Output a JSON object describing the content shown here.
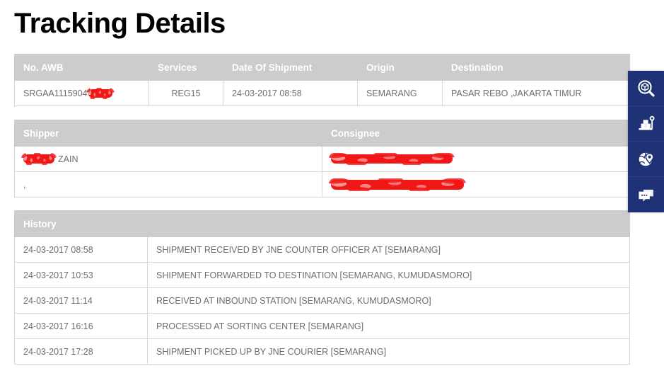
{
  "page": {
    "title": "Tracking Details"
  },
  "shipment_table": {
    "headers": [
      "No. AWB",
      "Services",
      "Date Of Shipment",
      "Origin",
      "Destination"
    ],
    "row": {
      "awb": "SRGAA1115904",
      "awb_redacted": true,
      "services": "REG15",
      "date_of_shipment": "24-03-2017 08:58",
      "origin": "SEMARANG",
      "destination": "PASAR REBO ,JAKARTA TIMUR"
    }
  },
  "parties_table": {
    "headers": [
      "Shipper",
      "Consignee"
    ],
    "rows": [
      {
        "shipper": "ZAIN",
        "shipper_redacted": true,
        "consignee": "",
        "consignee_redacted": true
      },
      {
        "shipper": ",",
        "shipper_redacted": false,
        "consignee": "",
        "consignee_redacted": true
      }
    ]
  },
  "history_table": {
    "header": "History",
    "rows": [
      {
        "time": "24-03-2017 08:58",
        "status": "SHIPMENT RECEIVED BY JNE COUNTER OFFICER AT [SEMARANG]"
      },
      {
        "time": "24-03-2017 10:53",
        "status": "SHIPMENT FORWARDED TO DESTINATION [SEMARANG, KUMUDASMORO]"
      },
      {
        "time": "24-03-2017 11:14",
        "status": "RECEIVED AT INBOUND STATION [SEMARANG, KUMUDASMORO]"
      },
      {
        "time": "24-03-2017 16:16",
        "status": "PROCESSED AT SORTING CENTER [SEMARANG]"
      },
      {
        "time": "24-03-2017 17:28",
        "status": "SHIPMENT PICKED UP BY JNE COURIER [SEMARANG]"
      }
    ]
  },
  "side_rail": {
    "items": [
      {
        "icon": "package-search-icon"
      },
      {
        "icon": "weighing-scale-boxes-icon"
      },
      {
        "icon": "globe-location-pin-icon"
      },
      {
        "icon": "chat-bubbles-icon"
      }
    ]
  },
  "colors": {
    "rail_background": "#1e3275",
    "table_header_background": "#cccccc",
    "table_header_text": "#ffffff",
    "redaction": "#ef1616",
    "body_text": "#6d6d6d",
    "title_text": "#000000"
  }
}
